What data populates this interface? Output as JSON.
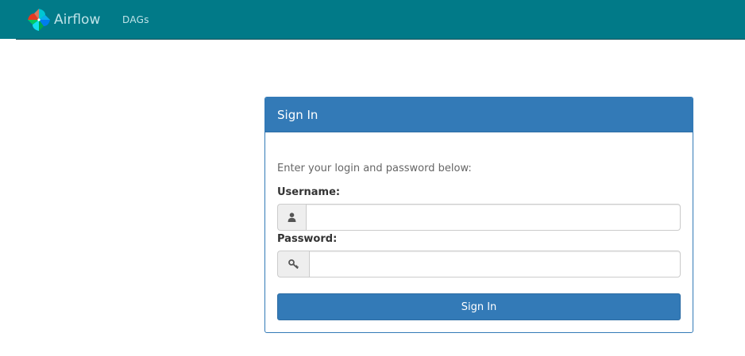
{
  "navbar": {
    "brand_text": "Airflow",
    "brand_logo_icon": "airflow-pinwheel-icon",
    "links": [
      {
        "label": "DAGs"
      }
    ],
    "background_color": "#017a88"
  },
  "login_panel": {
    "title": "Sign In",
    "intro_text": "Enter your login and password below:",
    "username": {
      "label": "Username:",
      "icon": "user-icon",
      "value": "",
      "placeholder": ""
    },
    "password": {
      "label": "Password:",
      "icon": "key-icon",
      "value": "",
      "placeholder": ""
    },
    "submit_label": "Sign In",
    "accent_color": "#337ab7"
  }
}
